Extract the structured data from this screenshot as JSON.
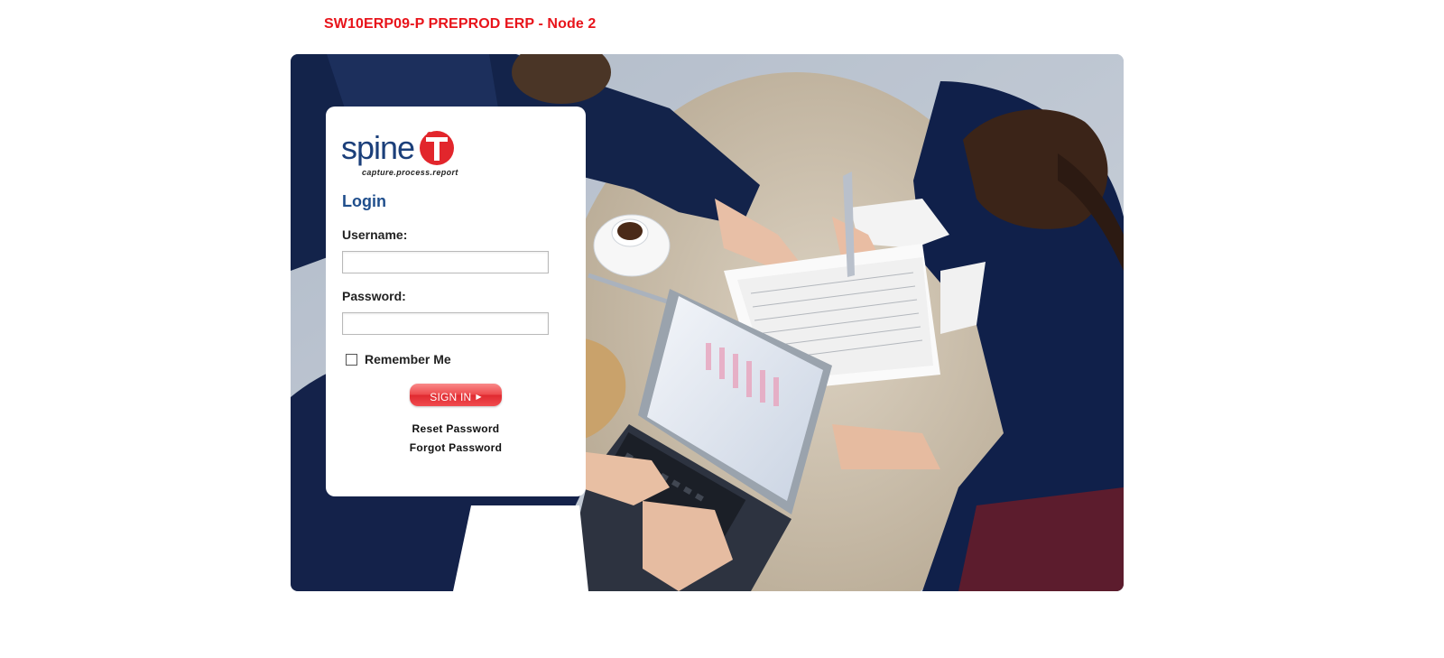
{
  "header": {
    "environment_title": "SW10ERP09-P PREPROD ERP - Node 2"
  },
  "logo": {
    "word": "spine",
    "badge_letter": "iT",
    "tagline": "capture.process.report",
    "icon": "spineit-logo-icon"
  },
  "login": {
    "heading": "Login",
    "username_label": "Username:",
    "username_value": "",
    "password_label": "Password:",
    "password_value": "",
    "remember_label": "Remember Me",
    "remember_checked": false,
    "signin_label": "SIGN IN",
    "signin_icon": "play-arrow-icon",
    "reset_password": "Reset Password",
    "forgot_password": "Forgot Password"
  },
  "background": {
    "icon": "business-meeting-photo"
  },
  "colors": {
    "title": "#e8141b",
    "brand_blue": "#1b3f7a",
    "heading_blue": "#1f4e8c",
    "button_red": "#e8343a"
  }
}
